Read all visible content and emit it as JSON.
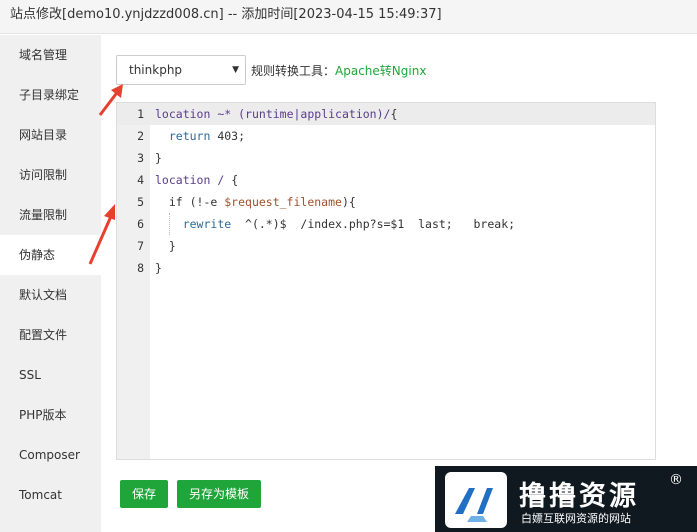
{
  "window": {
    "title": "站点修改[demo10.ynjdzzd008.cn] -- 添加时间[2023-04-15 15:49:37]"
  },
  "sidebar": {
    "items": [
      {
        "label": "域名管理"
      },
      {
        "label": "子目录绑定"
      },
      {
        "label": "网站目录"
      },
      {
        "label": "访问限制"
      },
      {
        "label": "流量限制"
      },
      {
        "label": "伪静态",
        "active": true
      },
      {
        "label": "默认文档"
      },
      {
        "label": "配置文件"
      },
      {
        "label": "SSL"
      },
      {
        "label": "PHP版本"
      },
      {
        "label": "Composer"
      },
      {
        "label": "Tomcat"
      }
    ]
  },
  "rewrite": {
    "template_select": {
      "value": "thinkphp"
    },
    "tool_label": "规则转换工具：",
    "tool_link": "Apache转Nginx"
  },
  "editor": {
    "lines": [
      {
        "num": "1",
        "text": "location ~* (runtime|application)/{"
      },
      {
        "num": "2",
        "text": "  return 403;"
      },
      {
        "num": "3",
        "text": "}"
      },
      {
        "num": "4",
        "text": "location / {"
      },
      {
        "num": "5",
        "text": "  if (!-e $request_filename){"
      },
      {
        "num": "6",
        "text": "    rewrite  ^(.*)$  /index.php?s=$1  last;   break;"
      },
      {
        "num": "7",
        "text": "  }"
      },
      {
        "num": "8",
        "text": "}"
      }
    ]
  },
  "buttons": {
    "save": "保存",
    "save_as_template": "另存为模板"
  },
  "watermark": {
    "name": "撸撸资源",
    "tagline": "白嫖互联网资源的网站",
    "mark": "®"
  },
  "colors": {
    "accent": "#20a53a",
    "annotation_arrow": "#e8402f"
  }
}
